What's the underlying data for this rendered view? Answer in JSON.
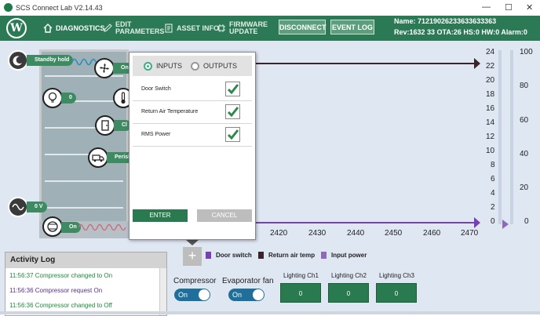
{
  "window": {
    "title": "SCS Connect Lab V2.14.43",
    "minimize": "—",
    "maximize": "☐",
    "close": "✕"
  },
  "header": {
    "logo_letter": "W",
    "nav": [
      {
        "label": "DIAGNOSTICS"
      },
      {
        "label": "EDIT PARAMETERS"
      },
      {
        "label": "ASSET INFO"
      },
      {
        "label": "FIRMWARE UPDATE"
      }
    ],
    "disconnect_label": "DISCONNECT",
    "eventlog_label": "EVENT LOG",
    "name_line": "Name: 71219026233633633363",
    "rev_line": "Rev:1632 33  OTA:26  HS:0  HW:0  Alarm:0"
  },
  "device": {
    "standby_label": "Standby hold",
    "fan_label": "On",
    "light_label": "0",
    "door_label": "Cl",
    "perish_label": "Perish",
    "voltage_label": "0 V",
    "compressor_label": "On"
  },
  "dialog": {
    "tab_inputs": "INPUTS",
    "tab_outputs": "OUTPUTS",
    "rows": [
      {
        "label": "Door Switch",
        "checked": true
      },
      {
        "label": "Return Air Temperature",
        "checked": true
      },
      {
        "label": "RMS Power",
        "checked": true
      }
    ],
    "enter_label": "ENTER",
    "cancel_label": "CANCEL"
  },
  "chart_data": {
    "type": "line",
    "x_ticks": [
      "2420",
      "2430",
      "2440",
      "2450",
      "2460",
      "2470"
    ],
    "y_left_ticks": [
      "24",
      "22",
      "20",
      "18",
      "16",
      "14",
      "12",
      "10",
      "8",
      "6",
      "4",
      "2",
      "0"
    ],
    "y_right_ticks": [
      "100",
      "80",
      "60",
      "40",
      "20",
      "0"
    ],
    "series": [
      {
        "name": "Door switch",
        "color": "#7a3fb0"
      },
      {
        "name": "Return air temp",
        "color": "#3b2428"
      },
      {
        "name": "Input power",
        "color": "#8e6ab8"
      }
    ],
    "add_label": "+"
  },
  "activity": {
    "title": "Activity Log",
    "entries": [
      {
        "time": "11:56:37",
        "text": "Compressor  changed to On",
        "color": "#1e8a3e"
      },
      {
        "time": "11:56:36",
        "text": "Compressor  request On",
        "color": "#5c2d91"
      },
      {
        "time": "11:56:36",
        "text": "Compressor  changed to Off",
        "color": "#1e8a3e"
      }
    ]
  },
  "controls": {
    "compressor_label": "Compressor",
    "compressor_state": "On",
    "evapfan_label": "Evaporator fan",
    "evapfan_state": "On",
    "lighting": [
      {
        "label": "Lighting Ch1",
        "value": "0"
      },
      {
        "label": "Lighting Ch2",
        "value": "0"
      },
      {
        "label": "Lighting Ch3",
        "value": "0"
      }
    ]
  }
}
